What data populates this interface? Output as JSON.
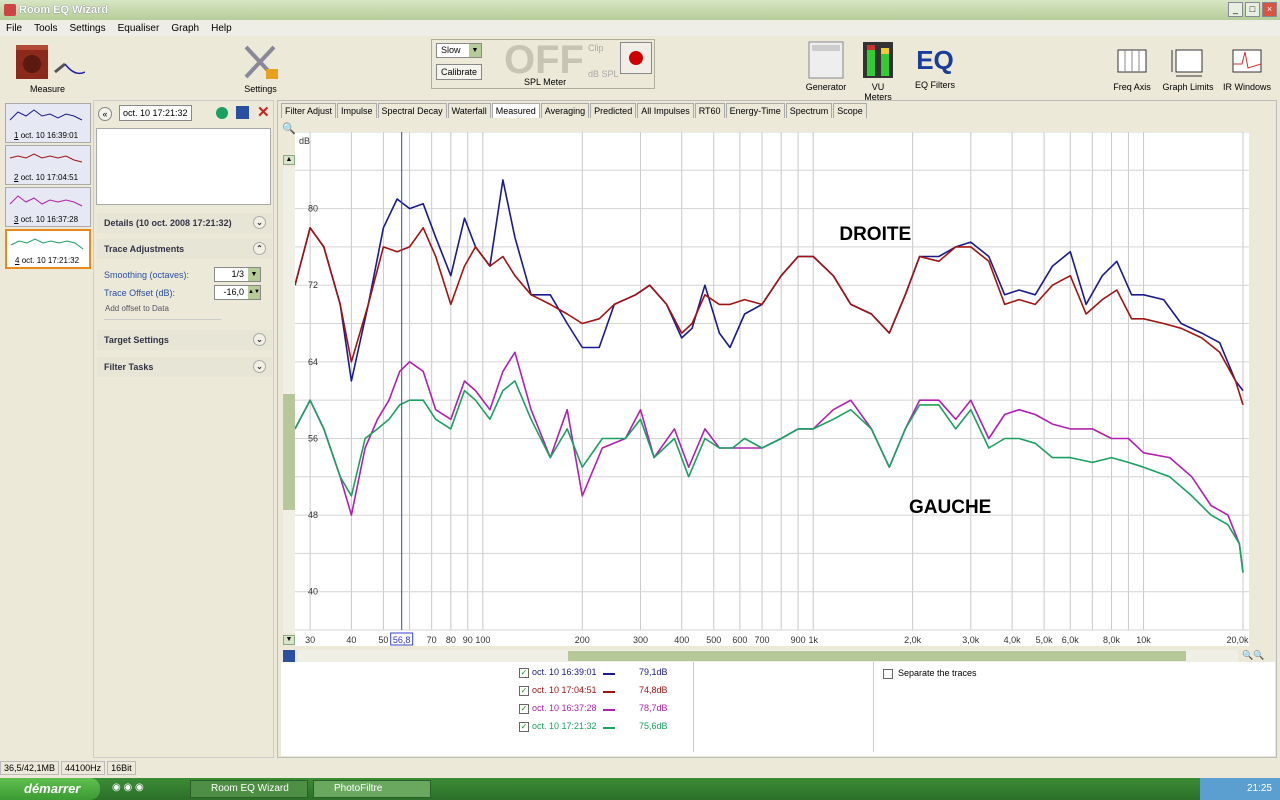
{
  "window": {
    "title": "Room EQ Wizard"
  },
  "menu": [
    "File",
    "Tools",
    "Settings",
    "Equaliser",
    "Graph",
    "Help"
  ],
  "toolbar": {
    "measure": "Measure",
    "settings": "Settings",
    "speed": "Slow",
    "calibrate": "Calibrate",
    "spl_value": "OFF",
    "clip": "Clip",
    "db_spl": "dB SPL",
    "spl_meter": "SPL Meter",
    "generator": "Generator",
    "vu_meters": "VU Meters",
    "eq_filters": "EQ Filters",
    "eq_logo": "EQ",
    "freq_axis": "Freq Axis",
    "graph_limits": "Graph Limits",
    "ir_windows": "IR Windows"
  },
  "traces": [
    {
      "num": "1",
      "label": "oct. 10 16:39:01",
      "color": "#1a1a8c"
    },
    {
      "num": "2",
      "label": "oct. 10 17:04:51",
      "color": "#a01414"
    },
    {
      "num": "3",
      "label": "oct. 10 16:37:28",
      "color": "#b020b0"
    },
    {
      "num": "4",
      "label": "oct. 10 17:21:32",
      "color": "#1aa060"
    }
  ],
  "panel": {
    "selected_name": "oct. 10 17:21:32",
    "details": "Details  (10 oct. 2008 17:21:32)",
    "trace_adjustments": "Trace Adjustments",
    "smoothing_label": "Smoothing (octaves):",
    "smoothing_value": "1/3",
    "offset_label": "Trace Offset (dB):",
    "offset_value": "-16,0",
    "add_offset": "Add offset to Data",
    "target_settings": "Target Settings",
    "filter_tasks": "Filter Tasks"
  },
  "tabs": [
    "Filter Adjust",
    "Impulse",
    "Spectral Decay",
    "Waterfall",
    "Measured",
    "Averaging",
    "Predicted",
    "All Impulses",
    "RT60",
    "Energy-Time",
    "Spectrum",
    "Scope"
  ],
  "active_tab": "Measured",
  "annotations": {
    "droite": "DROITE",
    "gauche": "GAUCHE"
  },
  "cursor_label": "56,8",
  "legend": [
    {
      "label": "oct. 10 16:39:01",
      "value": "79,1dB",
      "color": "#1a1a8c"
    },
    {
      "label": "oct. 10 17:04:51",
      "value": "74,8dB",
      "color": "#a01414"
    },
    {
      "label": "oct. 10 16:37:28",
      "value": "78,7dB",
      "color": "#b020b0"
    },
    {
      "label": "oct. 10 17:21:32",
      "value": "75,6dB",
      "color": "#1aa060"
    }
  ],
  "separate_traces": "Separate the traces",
  "status": [
    "36,5/42,1MB",
    "44100Hz",
    "16Bit"
  ],
  "taskbar": {
    "start": "démarrer",
    "item1": "Room EQ Wizard",
    "item2": "PhotoFiltre",
    "clock": "21:25"
  },
  "chart_data": {
    "type": "line",
    "xlabel": "",
    "ylabel": "dB",
    "xscale": "log",
    "xlim": [
      27,
      20000
    ],
    "ylim": [
      36,
      88
    ],
    "yticks": [
      40,
      48,
      56,
      64,
      72,
      80
    ],
    "xticks": [
      {
        "v": 30,
        "t": "30"
      },
      {
        "v": 40,
        "t": "40"
      },
      {
        "v": 50,
        "t": "50"
      },
      {
        "v": 70,
        "t": "70"
      },
      {
        "v": 80,
        "t": "80"
      },
      {
        "v": 90,
        "t": "90"
      },
      {
        "v": 100,
        "t": "100"
      },
      {
        "v": 200,
        "t": "200"
      },
      {
        "v": 300,
        "t": "300"
      },
      {
        "v": 400,
        "t": "400"
      },
      {
        "v": 500,
        "t": "500"
      },
      {
        "v": 600,
        "t": "600"
      },
      {
        "v": 700,
        "t": "700"
      },
      {
        "v": 900,
        "t": "900"
      },
      {
        "v": 1000,
        "t": "1k"
      },
      {
        "v": 2000,
        "t": "2,0k"
      },
      {
        "v": 3000,
        "t": "3,0k"
      },
      {
        "v": 4000,
        "t": "4,0k"
      },
      {
        "v": 5000,
        "t": "5,0k"
      },
      {
        "v": 6000,
        "t": "6,0k"
      },
      {
        "v": 8000,
        "t": "8,0k"
      },
      {
        "v": 10000,
        "t": "10k"
      },
      {
        "v": 20000,
        "t": "20,0kHz"
      }
    ],
    "cursor_x": 56.8,
    "series": [
      {
        "color": "#1a1a8c",
        "x": [
          27,
          30,
          33,
          37,
          40,
          45,
          50,
          55,
          60,
          66,
          72,
          80,
          88,
          95,
          105,
          115,
          125,
          140,
          160,
          180,
          200,
          225,
          250,
          290,
          320,
          360,
          400,
          430,
          470,
          520,
          560,
          620,
          700,
          800,
          900,
          1000,
          1150,
          1300,
          1500,
          1700,
          1900,
          2100,
          2400,
          2700,
          3000,
          3400,
          3800,
          4200,
          4700,
          5300,
          6000,
          6700,
          7500,
          8300,
          9200,
          10000,
          11500,
          13000,
          15000,
          17000,
          19000,
          20000
        ],
        "y": [
          72,
          78,
          76,
          70,
          62,
          70,
          78,
          81,
          80,
          80.5,
          77,
          73,
          79,
          76,
          74,
          83,
          77,
          71,
          71,
          68,
          65.5,
          65.5,
          70,
          71,
          72,
          70,
          66.5,
          67.5,
          72,
          67,
          65.5,
          69,
          70,
          73,
          75,
          75,
          73,
          70,
          69,
          67,
          71,
          75,
          75,
          76,
          76.5,
          75,
          71,
          71.5,
          71,
          74,
          75.5,
          70,
          73,
          74.5,
          71,
          71,
          70.5,
          68,
          67,
          66,
          62,
          61
        ]
      },
      {
        "color": "#a01414",
        "x": [
          27,
          30,
          33,
          37,
          40,
          45,
          50,
          55,
          60,
          66,
          72,
          80,
          88,
          95,
          105,
          115,
          125,
          140,
          160,
          180,
          200,
          225,
          250,
          290,
          320,
          360,
          400,
          430,
          470,
          520,
          560,
          620,
          700,
          800,
          900,
          1000,
          1150,
          1300,
          1500,
          1700,
          1900,
          2100,
          2400,
          2700,
          3000,
          3400,
          3800,
          4200,
          4700,
          5300,
          6000,
          6700,
          7500,
          8300,
          9200,
          10000,
          11500,
          13000,
          15000,
          17000,
          19000,
          20000
        ],
        "y": [
          72,
          78,
          76,
          70,
          64,
          70,
          76,
          75.5,
          76,
          78,
          75,
          70,
          74,
          76,
          74,
          75,
          73,
          71,
          70,
          69,
          68,
          68.5,
          70,
          71,
          72,
          70,
          67,
          68,
          71,
          70,
          70,
          70.5,
          70,
          73,
          75,
          75,
          73,
          70,
          69,
          67,
          71,
          75,
          74.5,
          76,
          76,
          74.5,
          70,
          70.5,
          70,
          72,
          73,
          69,
          70.5,
          71.5,
          68.5,
          68.5,
          68,
          67.5,
          66.5,
          65,
          62,
          59.5
        ]
      },
      {
        "color": "#b020b0",
        "x": [
          27,
          30,
          33,
          37,
          40,
          44,
          48,
          52,
          56,
          60,
          66,
          72,
          80,
          88,
          95,
          105,
          115,
          125,
          140,
          160,
          180,
          200,
          230,
          270,
          300,
          330,
          380,
          420,
          470,
          520,
          570,
          620,
          700,
          800,
          900,
          1000,
          1150,
          1300,
          1500,
          1700,
          1900,
          2100,
          2400,
          2700,
          3000,
          3400,
          3800,
          4200,
          4700,
          5300,
          6000,
          7000,
          8000,
          9000,
          10000,
          12000,
          14000,
          16000,
          18000,
          19500,
          20000
        ],
        "y": [
          57,
          60,
          57,
          52,
          48,
          55,
          58,
          60,
          63,
          64,
          63,
          59,
          58,
          62,
          61,
          59,
          63,
          65,
          59,
          54,
          59,
          50,
          55,
          56,
          59,
          54,
          57,
          53,
          57,
          55,
          55,
          55,
          55,
          56,
          57,
          57,
          59,
          60,
          57,
          53,
          57,
          60,
          60,
          58,
          60,
          56,
          58.5,
          59,
          58.5,
          57.5,
          57,
          57,
          56,
          56,
          54.5,
          54,
          52,
          49,
          48,
          45,
          42
        ]
      },
      {
        "color": "#1aa060",
        "x": [
          27,
          30,
          33,
          37,
          40,
          44,
          48,
          52,
          56,
          60,
          66,
          72,
          80,
          88,
          95,
          105,
          115,
          125,
          140,
          160,
          180,
          200,
          230,
          270,
          300,
          330,
          380,
          420,
          470,
          520,
          570,
          620,
          700,
          800,
          900,
          1000,
          1150,
          1300,
          1500,
          1700,
          1900,
          2100,
          2400,
          2700,
          3000,
          3400,
          3800,
          4200,
          4700,
          5300,
          6000,
          7000,
          8000,
          9000,
          10000,
          12000,
          14000,
          16000,
          18000,
          19500,
          20000
        ],
        "y": [
          57,
          60,
          57,
          52,
          50,
          56,
          57,
          58,
          59.5,
          60,
          60,
          58,
          57,
          61,
          60,
          58,
          61,
          62,
          58,
          54,
          57,
          53,
          56,
          56,
          58,
          54,
          56,
          52,
          56,
          55,
          55,
          56,
          55,
          56,
          57,
          57,
          58,
          59,
          57,
          53,
          57,
          59.5,
          59.5,
          57,
          59,
          55,
          56,
          56,
          55.5,
          54,
          54,
          53.5,
          54,
          53.5,
          53,
          52,
          50,
          48,
          47,
          45,
          42
        ]
      }
    ]
  }
}
